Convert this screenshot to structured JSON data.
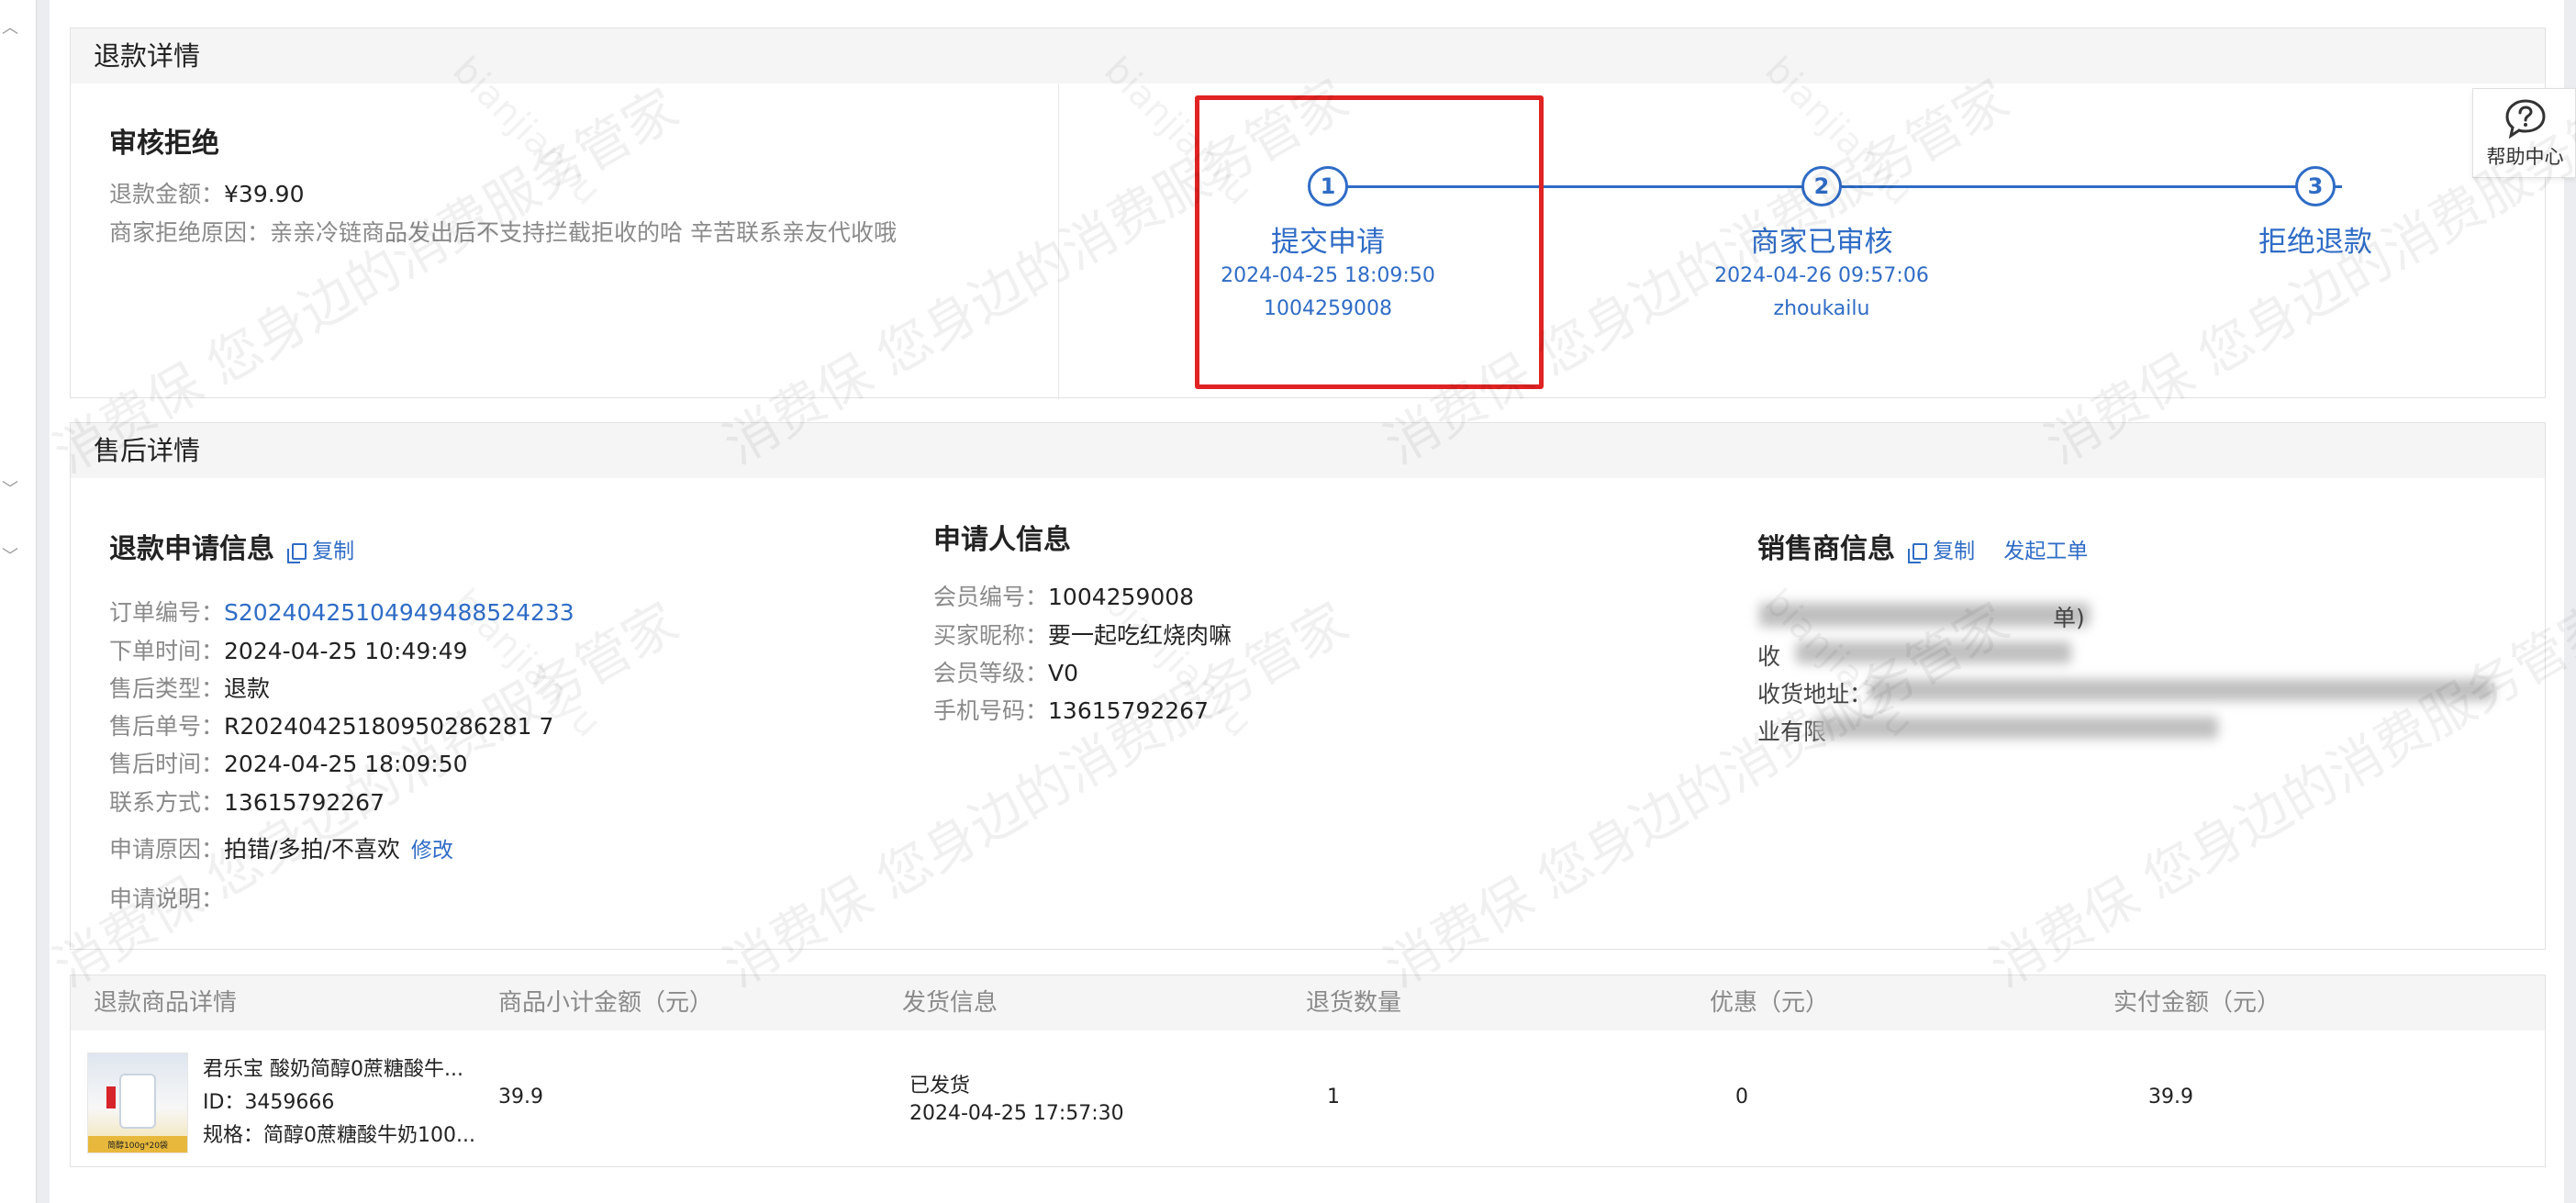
{
  "refund_section": {
    "title": "退款详情",
    "status": "审核拒绝",
    "amount_label": "退款金额：",
    "amount_value": "¥39.90",
    "reason_label": "商家拒绝原因：",
    "reason_value": "亲亲冷链商品发出后不支持拦截拒收的哈 辛苦联系亲友代收哦",
    "steps": [
      {
        "number": "1",
        "title": "提交申请",
        "time": "2024-04-25 18:09:50",
        "actor": "1004259008"
      },
      {
        "number": "2",
        "title": "商家已审核",
        "time": "2024-04-26 09:57:06",
        "actor": "zhoukailu"
      },
      {
        "number": "3",
        "title": "拒绝退款"
      }
    ]
  },
  "aftersale_section": {
    "title": "售后详情",
    "refund_info": {
      "title": "退款申请信息",
      "copy_label": "复制",
      "rows": [
        {
          "label": "订单编号：",
          "value": "S20240425104949488524233"
        },
        {
          "label": "下单时间：",
          "value": "2024-04-25 10:49:49"
        },
        {
          "label": "售后类型：",
          "value": "退款"
        },
        {
          "label": "售后单号：",
          "value": "R20240425180950286281 7"
        },
        {
          "label": "售后时间：",
          "value": "2024-04-25 18:09:50"
        },
        {
          "label": "联系方式：",
          "value": "13615792267"
        },
        {
          "label": "申请原因：",
          "value": "拍错/多拍/不喜欢",
          "action": "修改"
        },
        {
          "label": "申请说明：",
          "value": ""
        }
      ]
    },
    "applicant_info": {
      "title": "申请人信息",
      "rows": [
        {
          "label": "会员编号：",
          "value": "1004259008"
        },
        {
          "label": "买家昵称：",
          "value": "要一起吃红烧肉嘛"
        },
        {
          "label": "会员等级：",
          "value": "V0"
        },
        {
          "label": "手机号码：",
          "value": "13615792267"
        }
      ]
    },
    "seller_info": {
      "title": "销售商信息",
      "copy_label": "复制",
      "ticket_label": "发起工单",
      "partial_texts": [
        "单)",
        "收",
        "收货地址：",
        "业有限"
      ]
    }
  },
  "goods_table": {
    "headers": [
      "退款商品详情",
      "商品小计金额（元）",
      "发货信息",
      "退货数量",
      "优惠（元）",
      "实付金额（元）"
    ],
    "row": {
      "name": "君乐宝 酸奶简醇0蔗糖酸牛...",
      "id_label": "ID：",
      "id_value": "3459666",
      "spec_label": "规格：",
      "spec_value": "简醇0蔗糖酸牛奶100...",
      "thumb_caption": "简醇100g*20袋",
      "subtotal": "39.9",
      "ship_status": "已发货",
      "ship_time": "2024-04-25 17:57:30",
      "quantity": "1",
      "discount": "0",
      "paid": "39.9"
    }
  },
  "help": {
    "label": "帮助中心"
  },
  "watermark": {
    "cn": "消费保 您身边的消费服务管家",
    "en": "bianjianyu"
  },
  "colors": {
    "accent": "#2f6cc6",
    "highlight": "#e02323",
    "muted": "#8a8a8a"
  },
  "icons": [
    "question-bubble-icon",
    "copy-icon",
    "chevron-up-icon",
    "chevron-down-icon"
  ]
}
